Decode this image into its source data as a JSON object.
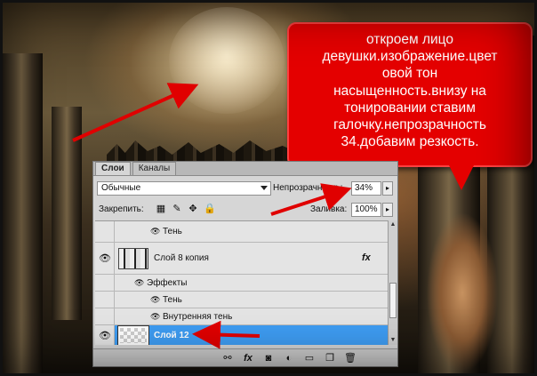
{
  "annotation": {
    "text": "откроем лицо\nдевушки.изображение.цвет\nовой тон\nнасыщенность.внизу на\nтонировании ставим\nгалочку.непрозрачность\n34.добавим резкость."
  },
  "panel": {
    "tabs": [
      {
        "label": "Слои",
        "active": true
      },
      {
        "label": "Каналы",
        "active": false
      }
    ],
    "blend_mode": "Обычные",
    "opacity_label": "Непрозрачность:",
    "opacity_value": "34%",
    "lock_label": "Закрепить:",
    "fill_label": "Заливка:",
    "fill_value": "100%",
    "layers": {
      "shadow_top": "Тень",
      "layer8_name": "Слой 8 копия",
      "effects_label": "Эффекты",
      "shadow_label": "Тень",
      "inner_shadow_label": "Внутренняя тень",
      "layer12_name": "Слой 12"
    },
    "fx_label": "fx"
  },
  "colors": {
    "annotation_bg": "#e40000",
    "selection": "#3e9cf2",
    "arrow": "#e00000"
  }
}
